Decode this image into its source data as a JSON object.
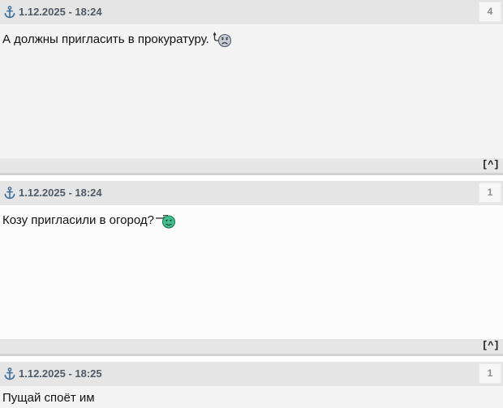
{
  "posts": [
    {
      "date": "1.12.2025 - 18:24",
      "count": "4",
      "text": "А должны пригласить в прокуратуру.",
      "smiley_icon": "sad-smiley-with-hook-icon",
      "top_link": "[^]"
    },
    {
      "date": "1.12.2025 - 18:24",
      "count": "1",
      "text": "Козу пригласили в огород?",
      "smiley_icon": "green-smiley-with-fork-icon",
      "top_link": "[^]"
    },
    {
      "date": "1.12.2025 - 18:25",
      "count": "1",
      "text": "Пущай споёт им"
    }
  ],
  "colors": {
    "header_bg": "#e5e5e5",
    "date_text": "#505a64",
    "anchor_blue": "#3c6e9a",
    "count_text": "#8c8c8c",
    "body_odd": "#f4f4f4",
    "body_even": "#fcfcfc",
    "footer_bg": "#e7e7e7"
  }
}
